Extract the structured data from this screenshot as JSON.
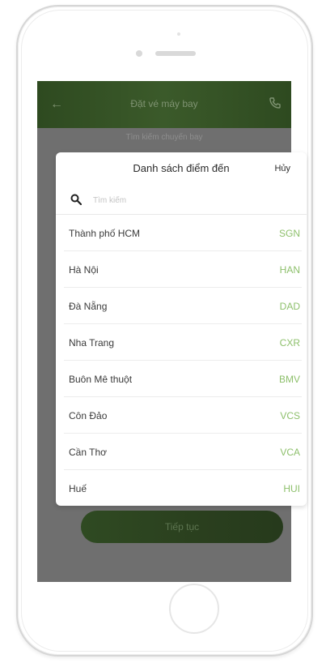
{
  "app_header": {
    "title": "Đặt vé máy bay"
  },
  "subheader": {
    "text": "Tìm kiếm chuyến bay"
  },
  "continue_button": {
    "label": "Tiếp tục"
  },
  "modal": {
    "title": "Danh sách điểm đến",
    "cancel_label": "Hủy",
    "search": {
      "placeholder": "Tìm kiếm",
      "value": ""
    },
    "items": [
      {
        "name": "Thành phố HCM",
        "code": "SGN"
      },
      {
        "name": "Hà Nội",
        "code": "HAN"
      },
      {
        "name": "Đà Nẵng",
        "code": "DAD"
      },
      {
        "name": "Nha Trang",
        "code": "CXR"
      },
      {
        "name": "Buôn Mê thuột",
        "code": "BMV"
      },
      {
        "name": "Côn Đảo",
        "code": "VCS"
      },
      {
        "name": "Cần Thơ",
        "code": "VCA"
      },
      {
        "name": "Huế",
        "code": "HUI"
      }
    ]
  },
  "colors": {
    "accent": "#8ec06c",
    "header_bg": "#3b5a2a",
    "overlay": "#6f6f6f"
  },
  "icons": {
    "back": "back-arrow-icon",
    "phone": "phone-icon",
    "search": "search-icon"
  }
}
